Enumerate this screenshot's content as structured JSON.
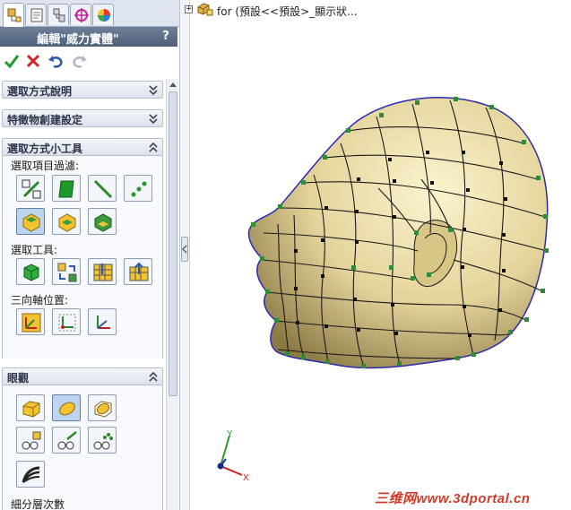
{
  "panel": {
    "title": "編輯\"威力實體\"",
    "help": "?",
    "tabs": [
      "property-manager",
      "configuration",
      "dimxpert",
      "display-manager",
      "appearances"
    ],
    "groups": {
      "selection_help": {
        "label": "選取方式說明"
      },
      "feature_settings": {
        "label": "特徵物創建設定"
      },
      "selection_tools": {
        "label": "選取方式小工具",
        "filter_label": "選取項目過濾:",
        "tools_label": "選取工具:",
        "triad_label": "三向軸位置:"
      },
      "display": {
        "label": "眼觀",
        "subdivision_label": "細分層次數"
      }
    }
  },
  "tree": {
    "expand": "+",
    "text": "for  (預設<<預設>_顯示狀..."
  },
  "triad": {
    "x": "X",
    "y": "Y"
  },
  "watermark": "三维网www.3dportal.cn",
  "colors": {
    "accept": "#1e9a2e",
    "cancel": "#d42020",
    "model_fill": "#e4d49a",
    "mesh": "#1a1a1a",
    "vertex": "#2f8a3a",
    "silhouette": "#2a2ab0"
  }
}
